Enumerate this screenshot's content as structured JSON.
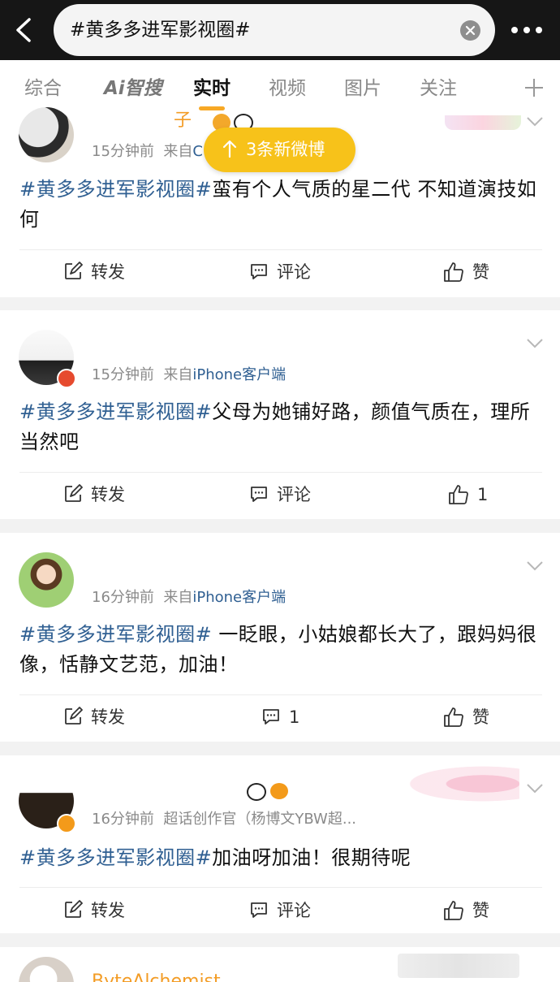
{
  "search": {
    "query": "#黄多多进军影视圈#"
  },
  "tabs": [
    {
      "label": "综合"
    },
    {
      "label": "Ai智搜"
    },
    {
      "label": "实时"
    },
    {
      "label": "视频"
    },
    {
      "label": "图片"
    },
    {
      "label": "关注"
    }
  ],
  "new_posts_pill": "3条新微博",
  "posts": [
    {
      "time": "15分钟前",
      "source_prefix": "来自",
      "source": "C",
      "name_fragment": "子",
      "topic": "#黄多多进军影视圈#",
      "text": "蛮有个人气质的星二代 不知道演技如何",
      "repost": "转发",
      "comment": "评论",
      "like": "赞"
    },
    {
      "time": "15分钟前",
      "source_prefix": "来自",
      "source": "iPhone客户端",
      "topic": "#黄多多进军影视圈#",
      "text": "父母为她铺好路，颜值气质在，理所当然吧",
      "repost": "转发",
      "comment": "评论",
      "like": "1"
    },
    {
      "time": "16分钟前",
      "source_prefix": "来自",
      "source": "iPhone客户端",
      "topic": "#黄多多进军影视圈#",
      "text": " 一眨眼，小姑娘都长大了，跟妈妈很像，恬静文艺范，加油！",
      "repost": "转发",
      "comment": "1",
      "like": "赞"
    },
    {
      "time": "16分钟前",
      "source_prefix": "",
      "source": "超话创作官（杨博文YBW超...",
      "topic": "#黄多多进军影视圈#",
      "text": "加油呀加油！很期待呢",
      "repost": "转发",
      "comment": "评论",
      "like": "赞"
    }
  ],
  "partial_user": "ByteAlchemist",
  "colors": {
    "topic_blue": "#2f5f92",
    "accent_orange": "#f7a825",
    "pill_yellow": "#f7c21a"
  }
}
